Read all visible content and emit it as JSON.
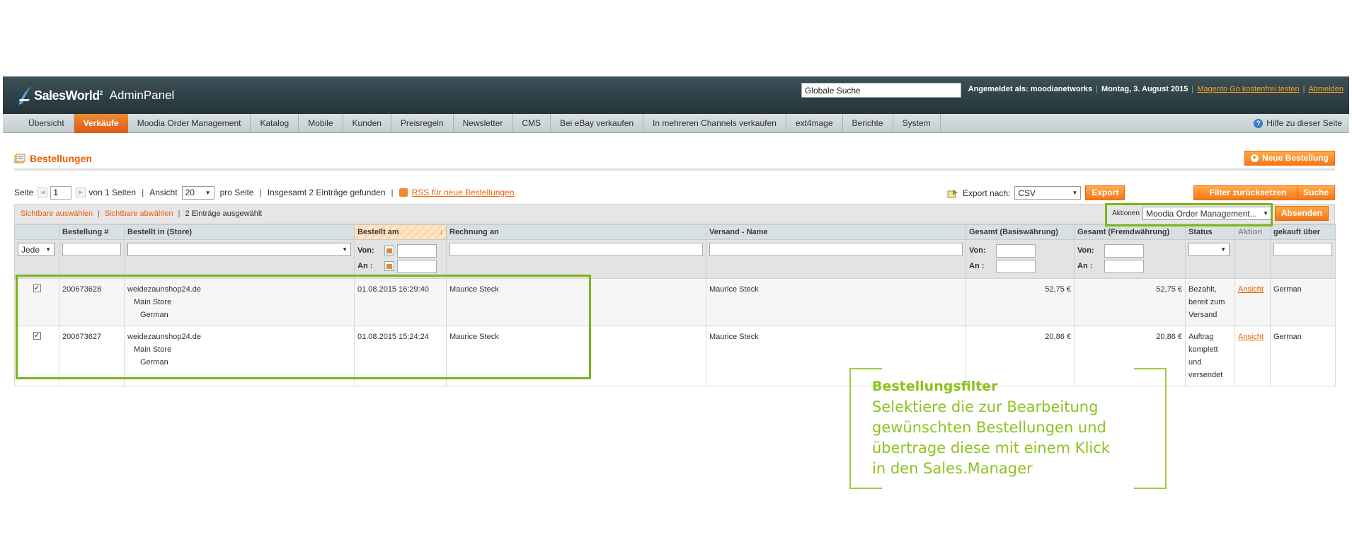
{
  "header": {
    "brand": "SalesWorld",
    "brand_sup": "2",
    "panel": "AdminPanel",
    "global_search": "Globale Suche",
    "logged_in_label": "Angemeldet als: moodianetworks",
    "date": "Montag, 3. August 2015",
    "link_try": "Magento Go kostenfrei testen",
    "link_logout": "Abmelden"
  },
  "nav": {
    "items": [
      "Übersicht",
      "Verkäufe",
      "Moodia Order Management",
      "Katalog",
      "Mobile",
      "Kunden",
      "Preisregeln",
      "Newsletter",
      "CMS",
      "Bei eBay verkaufen",
      "In mehreren Channels verkaufen",
      "ext4mage",
      "Berichte",
      "System"
    ],
    "active": "Verkäufe",
    "help": "Hilfe zu dieser Seite"
  },
  "page": {
    "title": "Bestellungen",
    "new_order": "Neue Bestellung"
  },
  "pager": {
    "seite": "Seite",
    "page_value": "1",
    "of_pages": "von 1 Seiten",
    "ansicht": "Ansicht",
    "per_page": "20",
    "pro_seite": "pro Seite",
    "total": "Insgesamt 2 Einträge gefunden",
    "rss": "RSS für neue Bestellungen",
    "export_label": "Export nach:",
    "export_format": "CSV",
    "export_btn": "Export",
    "reset_btn": "Filter zurücksetzen",
    "search_btn": "Suche"
  },
  "massaction": {
    "select_visible": "Sichtbare auswählen",
    "deselect_visible": "Sichtbare abwählen",
    "selected": "2 Einträge ausgewählt",
    "actions_label": "Aktionen",
    "action_value": "Moodia Order Management...",
    "submit": "Absenden"
  },
  "grid": {
    "columns": [
      "",
      "Bestellung #",
      "Bestellt in (Store)",
      "Bestellt am",
      "Rechnung an",
      "Versand - Name",
      "Gesamt (Basiswährung)",
      "Gesamt (Fremdwährung)",
      "Status",
      "Aktion",
      "gekauft über"
    ],
    "filter": {
      "any": "Jede",
      "from": "Von:",
      "to": "An :"
    },
    "rows": [
      {
        "order": "200673628",
        "store1": "weidezaunshop24.de",
        "store2": "Main Store",
        "store3": "German",
        "date": "01.08.2015 16:29:40",
        "bill": "Maurice Steck",
        "ship": "Maurice Steck",
        "base": "52,75 €",
        "purchased": "52,75 €",
        "status": "Bezahlt, bereit zum Versand",
        "action": "Ansicht",
        "via": "German",
        "checked": true
      },
      {
        "order": "200673627",
        "store1": "weidezaunshop24.de",
        "store2": "Main Store",
        "store3": "German",
        "date": "01.08.2015 15:24:24",
        "bill": "Maurice Steck",
        "ship": "Maurice Steck",
        "base": "20,86 €",
        "purchased": "20,86 €",
        "status": "Auftrag komplett und versendet",
        "action": "Ansicht",
        "via": "German",
        "checked": true
      }
    ]
  },
  "callout": {
    "title": "Bestellungsfilter",
    "line1": "Selektiere die zur Bearbeitung",
    "line2": "gewünschten Bestellungen und",
    "line3": "übertrage diese mit einem Klick",
    "line4": "in den Sales.Manager"
  },
  "colors": {
    "accent": "#eb5e00",
    "highlight": "#7cb51b",
    "header": "#2d3f46"
  }
}
